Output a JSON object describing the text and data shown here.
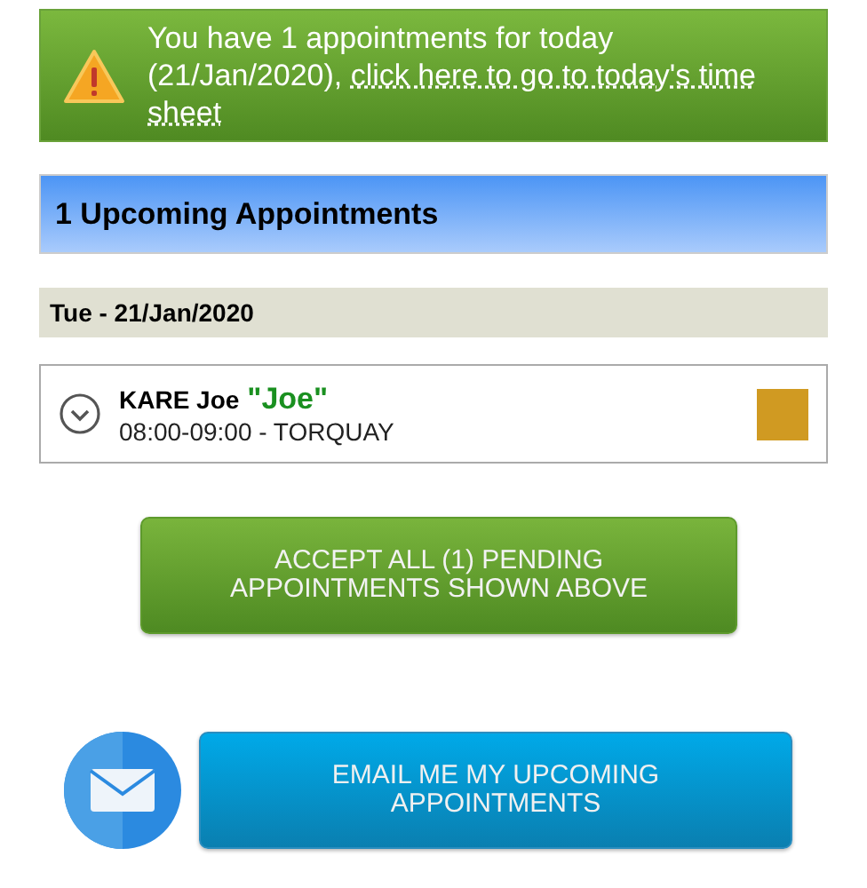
{
  "alert": {
    "text": "You have 1 appointments for today (21/Jan/2020), ",
    "link_lines": [
      "click here to go to today's time",
      "sheet"
    ]
  },
  "heading": "1 Upcoming Appointments",
  "days": [
    {
      "date": "Tue - 21/Jan/2020",
      "appointments": [
        {
          "name": "KARE Joe",
          "nickname": "\"Joe\"",
          "details": "08:00-09:00 - TORQUAY",
          "color": "#d09a22"
        }
      ]
    }
  ],
  "accept_button": "ACCEPT ALL (1) PENDING APPOINTMENTS SHOWN ABOVE",
  "email_button": "EMAIL ME MY UPCOMING APPOINTMENTS"
}
